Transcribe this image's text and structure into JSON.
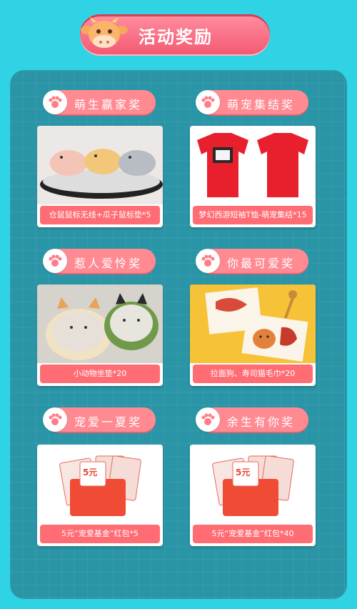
{
  "header": {
    "title": "活动奖励"
  },
  "prizes": [
    {
      "award": "萌生赢家奖",
      "caption": "仓鼠鼠标无线+瓜子鼠标垫*5",
      "image": "hamster-mice"
    },
    {
      "award": "萌宠集结奖",
      "caption": "梦幻西游短袖T恤-萌宠集结*15",
      "image": "red-tshirts"
    },
    {
      "award": "惹人爱怜奖",
      "caption": "小动物坐垫*20",
      "image": "animal-cushions"
    },
    {
      "award": "你最可爱奖",
      "caption": "拉面狗、寿司猫毛巾*20",
      "image": "dog-cat-towels"
    },
    {
      "award": "宠爱一夏奖",
      "caption": "5元“宠爱基金”红包*5",
      "image": "red-envelopes"
    },
    {
      "award": "余生有你奖",
      "caption": "5元“宠爱基金”红包*40",
      "image": "red-envelopes"
    }
  ],
  "envelope_badge": "5元"
}
